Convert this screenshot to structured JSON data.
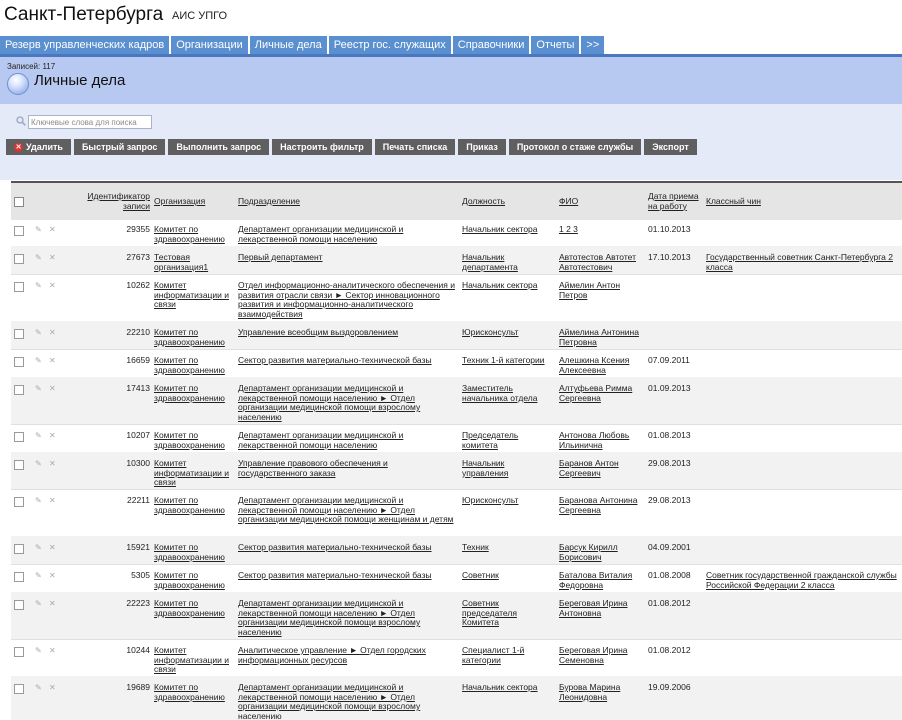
{
  "header": {
    "city": "Санкт-Петербурга",
    "system": "АИС УПГО"
  },
  "nav": {
    "tabs": [
      "Резерв управленческих кадров",
      "Организации",
      "Личные дела",
      "Реестр гос. служащих",
      "Справочники",
      "Отчеты",
      ">>"
    ]
  },
  "page": {
    "count": "Записей: 117",
    "title": "Личные дела"
  },
  "search": {
    "placeholder": "Ключевые слова для поиска"
  },
  "toolbar": {
    "buttons": [
      "Удалить",
      "Быстрый запрос",
      "Выполнить запрос",
      "Настроить фильтр",
      "Печать списка",
      "Приказ",
      "Протокол о стаже службы",
      "Экспорт"
    ]
  },
  "table": {
    "headers": [
      "Идентификатор записи",
      "Организация",
      "Подразделение",
      "Должность",
      "ФИО",
      "Дата приема на работу",
      "Классный чин"
    ],
    "rows": [
      {
        "id": "29355",
        "org": "Комитет по здравоохранению",
        "dept": "Департамент организации медицинской и лекарственной помощи населению",
        "pos": "Начальник сектора",
        "fio": "1 2 3",
        "date": "01.10.2013",
        "rank": ""
      },
      {
        "id": "27673",
        "org": "Тестовая организация1",
        "dept": "Первый департамент",
        "pos": "Начальник департамента",
        "fio": "Автотестов Автотет Автотестович",
        "date": "17.10.2013",
        "rank": "Государственный советник Санкт-Петербурга 2 класса"
      },
      {
        "id": "10262",
        "org": "Комитет информатизации и связи",
        "dept": "Отдел информационно-аналитического обеспечения и развития отрасли связи ► Сектор инновационного развития и информационно-аналитического взаимодействия",
        "pos": "Начальник сектора",
        "fio": "Аймелин Антон Петров",
        "date": "",
        "rank": ""
      },
      {
        "id": "22210",
        "org": "Комитет по здравоохранению",
        "dept": "Управление всеобщим выздоровлением",
        "pos": "Юрисконсульт",
        "fio": "Аймелина Антонина Петровна",
        "date": "",
        "rank": ""
      },
      {
        "id": "16659",
        "org": "Комитет по здравоохранению",
        "dept": "Сектор развития материально-технической базы",
        "pos": "Техник 1-й категории",
        "fio": "Алешкина Ксения Алексеевна",
        "date": "07.09.2011",
        "rank": ""
      },
      {
        "id": "17413",
        "org": "Комитет по здравоохранению",
        "dept": "Департамент организации медицинской и лекарственной помощи населению ► Отдел организации медицинской помощи взрослому населению",
        "pos": "Заместитель начальника отдела",
        "fio": "Алтуфьева Римма Сергеевна",
        "date": "01.09.2013",
        "rank": ""
      },
      {
        "id": "10207",
        "org": "Комитет по здравоохранению",
        "dept": "Департамент организации медицинской и лекарственной помощи населению",
        "pos": "Председатель комитета",
        "fio": "Антонова Любовь Ильинична",
        "date": "01.08.2013",
        "rank": ""
      },
      {
        "id": "10300",
        "org": "Комитет информатизации и связи",
        "dept": "Управление правового обеспечения и государственного заказа",
        "pos": "Начальник управления",
        "fio": "Баранов Антон Сергеевич",
        "date": "29.08.2013",
        "rank": ""
      },
      {
        "id": "22211",
        "org": "Комитет по здравоохранению",
        "dept": "Департамент организации медицинской и лекарственной помощи населению ► Отдел организации медицинской помощи женщинам и детям",
        "pos": "Юрисконсульт",
        "fio": "Баранова Антонина Сергеевна",
        "date": "29.08.2013",
        "rank": ""
      },
      {
        "id": "15921",
        "org": "Комитет по здравоохранению",
        "dept": "Сектор развития материально-технической базы",
        "pos": "Техник",
        "fio": "Барсук Кирилл Борисович",
        "date": "04.09.2001",
        "rank": ""
      },
      {
        "id": "5305",
        "org": "Комитет по здравоохранению",
        "dept": "Сектор развития материально-технической базы",
        "pos": "Советник",
        "fio": "Баталова Виталия Федоровна",
        "date": "01.08.2008",
        "rank": "Советник государственной гражданской службы Российской Федерации 2 класса"
      },
      {
        "id": "22223",
        "org": "Комитет по здравоохранению",
        "dept": "Департамент организации медицинской и лекарственной помощи населению ► Отдел организации медицинской помощи взрослому населению",
        "pos": "Советник председателя Комитета",
        "fio": "Береговая Ирина Антоновна",
        "date": "01.08.2012",
        "rank": ""
      },
      {
        "id": "10244",
        "org": "Комитет информатизации и связи",
        "dept": "Аналитическое управление ► Отдел городских информационных ресурсов",
        "pos": "Специалист 1-й категории",
        "fio": "Береговая Ирина Семеновна",
        "date": "01.08.2012",
        "rank": ""
      },
      {
        "id": "19689",
        "org": "Комитет по здравоохранению",
        "dept": "Департамент организации медицинской и лекарственной помощи населению ► Отдел организации медицинской помощи взрослому населению",
        "pos": "Начальник сектора",
        "fio": "Бурова Марина Леонидовна",
        "date": "19.09.2006",
        "rank": ""
      }
    ]
  }
}
